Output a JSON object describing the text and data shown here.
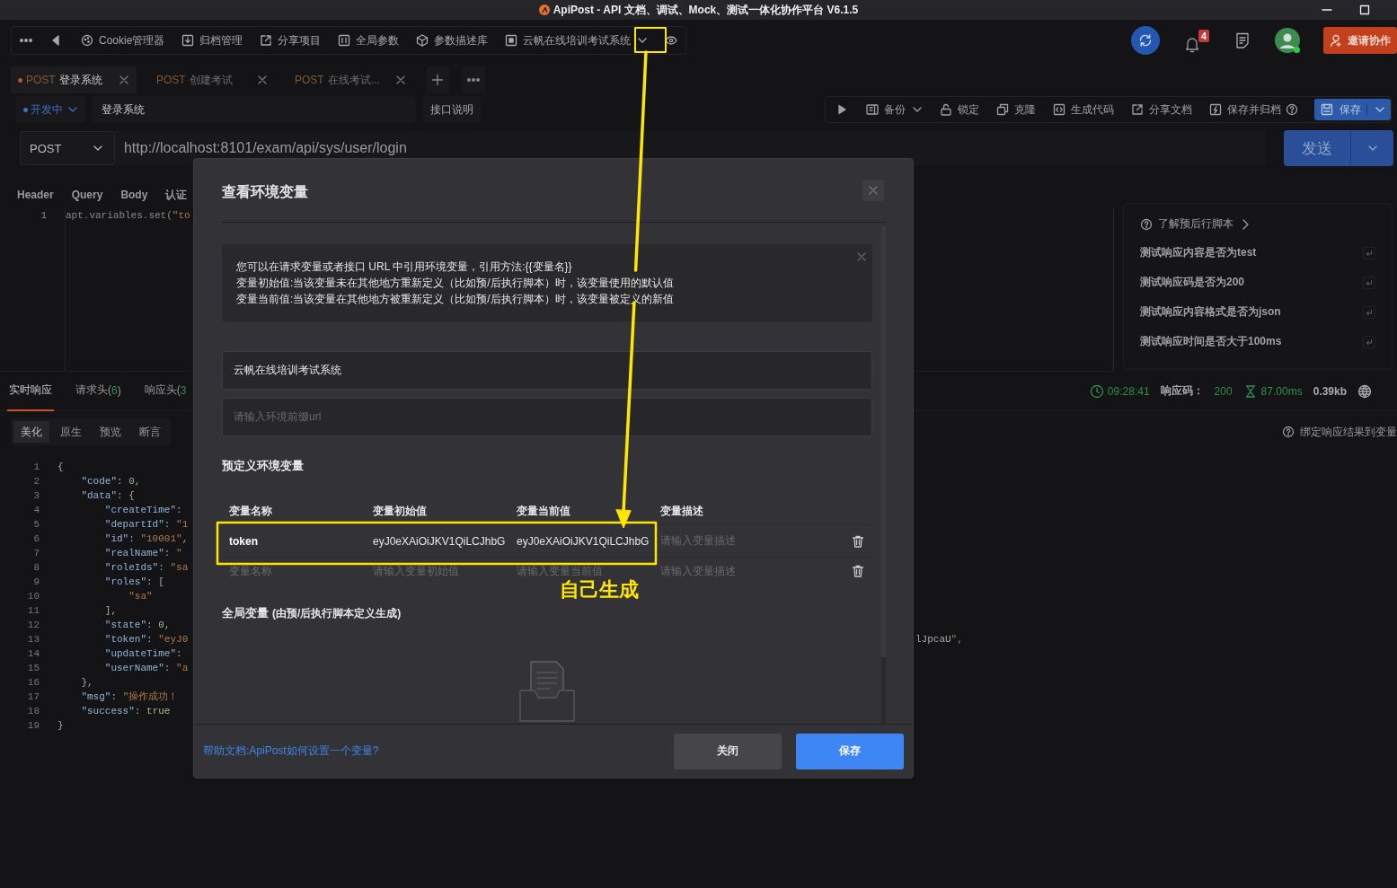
{
  "window": {
    "title": "ApiPost - API 文档、调试、Mock、测试一体化协作平台 V6.1.5"
  },
  "toolbar": {
    "items": [
      {
        "label": "Cookie管理器",
        "kind": "cookie"
      },
      {
        "label": "归档管理",
        "kind": "archive"
      },
      {
        "label": "分享项目",
        "kind": "share"
      },
      {
        "label": "全局参数",
        "kind": "params"
      },
      {
        "label": "参数描述库",
        "kind": "library"
      }
    ],
    "environment": "云帆在线培训考试系统",
    "notifications": "4",
    "invite": "邀请协作"
  },
  "tabs": [
    {
      "method": "POST",
      "label": "登录系统",
      "selected": true,
      "unsaved": true
    },
    {
      "method": "POST",
      "label": "创建考试",
      "selected": false,
      "unsaved": false
    },
    {
      "method": "POST",
      "label": "在线考试...",
      "selected": false,
      "unsaved": false
    }
  ],
  "request": {
    "status": "开发中",
    "name": "登录系统",
    "doc": "接口说明",
    "actions": [
      {
        "label": "备份",
        "kind": "backup"
      },
      {
        "label": "锁定",
        "kind": "lock"
      },
      {
        "label": "克隆",
        "kind": "clone"
      },
      {
        "label": "生成代码",
        "kind": "code"
      },
      {
        "label": "分享文档",
        "kind": "share"
      },
      {
        "label": "保存并归档",
        "kind": "archive"
      }
    ],
    "save": "保存",
    "method": "POST",
    "url": "http://localhost:8101/exam/api/sys/user/login",
    "send": "发送"
  },
  "params": {
    "tabs": [
      "Header",
      "Query",
      "Body",
      "认证"
    ],
    "script": [
      {
        "number": "1",
        "text": "apt.variables.set(\"to"
      }
    ]
  },
  "snippets": {
    "title": "了解预后行脚本",
    "items": [
      "测试响应内容是否为test",
      "测试响应码是否为200",
      "测试响应内容格式是否为json",
      "测试响应时间是否大于100ms"
    ]
  },
  "response": {
    "tabs": [
      {
        "label": "实时响应",
        "selected": true
      },
      {
        "label": "请求头(",
        "count": "6",
        "suffix": ")",
        "selected": false
      },
      {
        "label": "响应头(",
        "count": "3",
        "selected": false
      }
    ],
    "time": "09:28:41",
    "code_label": "响应码：",
    "code": "200",
    "duration": "87.00ms",
    "size": "0.39kb",
    "views": [
      {
        "label": "美化",
        "selected": true
      },
      {
        "label": "原生",
        "selected": false
      },
      {
        "label": "预览",
        "selected": false
      },
      {
        "label": "断言",
        "selected": false
      }
    ],
    "bind": "绑定响应结果到变量",
    "lines": [
      {
        "number": "1",
        "text": "{"
      },
      {
        "number": "2",
        "text": "    \"code\": 0,"
      },
      {
        "number": "3",
        "text": "    \"data\": {"
      },
      {
        "number": "4",
        "text": "        \"createTime\":"
      },
      {
        "number": "5",
        "text": "        \"departId\": \"1"
      },
      {
        "number": "6",
        "text": "        \"id\": \"10001\","
      },
      {
        "number": "7",
        "text": "        \"realName\": \""
      },
      {
        "number": "8",
        "text": "        \"roleIds\": \"sa"
      },
      {
        "number": "9",
        "text": "        \"roles\": ["
      },
      {
        "number": "10",
        "text": "            \"sa\""
      },
      {
        "number": "11",
        "text": "        ],"
      },
      {
        "number": "12",
        "text": "        \"state\": 0,"
      },
      {
        "number": "13",
        "text": "        \"token\": \"eyJ0",
        "tail": "lJpcaU\","
      },
      {
        "number": "14",
        "text": "        \"updateTime\":"
      },
      {
        "number": "15",
        "text": "        \"userName\": \"a"
      },
      {
        "number": "16",
        "text": "    },"
      },
      {
        "number": "17",
        "text": "    \"msg\": \"操作成功！"
      },
      {
        "number": "18",
        "text": "    \"success\": true"
      },
      {
        "number": "19",
        "text": "}"
      }
    ]
  },
  "dialog": {
    "title": "查看环境变量",
    "info": [
      "您可以在请求变量或者接口 URL 中引用环境变量，引用方法:{{变量名}}",
      "变量初始值:当该变量未在其他地方重新定义（比如预/后执行脚本）时，该变量使用的默认值",
      "变量当前值:当该变量在其他地方被重新定义（比如预/后执行脚本）时，该变量被定义的新值"
    ],
    "env_name": "云帆在线培训考试系统",
    "prefix_placeholder": "请输入环境前缀url",
    "predefined_title": "预定义环境变量",
    "columns": [
      "变量名称",
      "变量初始值",
      "变量当前值",
      "变量描述"
    ],
    "variables": [
      {
        "name": "token",
        "initial": "eyJ0eXAiOiJKV1QiLCJhbG",
        "current": "eyJ0eXAiOiJKV1QiLCJhbG",
        "description_placeholder": "请输入变量描述"
      }
    ],
    "new_row": {
      "name_placeholder": "变量名称",
      "initial_placeholder": "请输入变量初始值",
      "current_placeholder": "请输入变量当前值",
      "description_placeholder": "请输入变量描述"
    },
    "global_title": "全局变量",
    "global_note": "(由预/后执行脚本定义生成)",
    "help_link": "帮助文档:ApiPost如何设置一个变量?",
    "buttons": [
      {
        "label": "关闭",
        "kind": "secondary"
      },
      {
        "label": "保存",
        "kind": "primary"
      }
    ]
  },
  "annotation": {
    "label": "自己生成"
  }
}
